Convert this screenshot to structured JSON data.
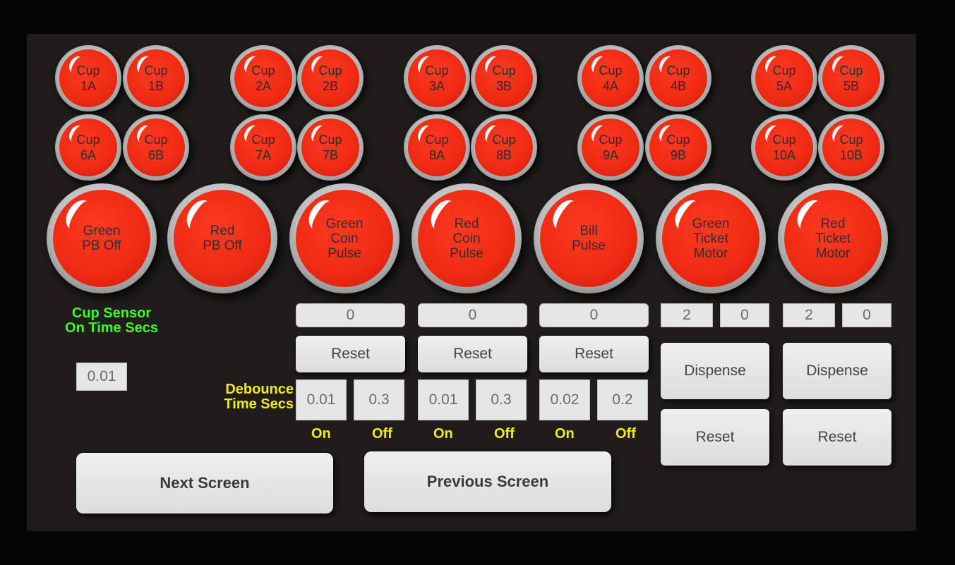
{
  "cups": [
    {
      "line1": "Cup",
      "line2": "1A"
    },
    {
      "line1": "Cup",
      "line2": "1B"
    },
    {
      "line1": "Cup",
      "line2": "2A"
    },
    {
      "line1": "Cup",
      "line2": "2B"
    },
    {
      "line1": "Cup",
      "line2": "3A"
    },
    {
      "line1": "Cup",
      "line2": "3B"
    },
    {
      "line1": "Cup",
      "line2": "4A"
    },
    {
      "line1": "Cup",
      "line2": "4B"
    },
    {
      "line1": "Cup",
      "line2": "5A"
    },
    {
      "line1": "Cup",
      "line2": "5B"
    },
    {
      "line1": "Cup",
      "line2": "6A"
    },
    {
      "line1": "Cup",
      "line2": "6B"
    },
    {
      "line1": "Cup",
      "line2": "7A"
    },
    {
      "line1": "Cup",
      "line2": "7B"
    },
    {
      "line1": "Cup",
      "line2": "8A"
    },
    {
      "line1": "Cup",
      "line2": "8B"
    },
    {
      "line1": "Cup",
      "line2": "9A"
    },
    {
      "line1": "Cup",
      "line2": "9B"
    },
    {
      "line1": "Cup",
      "line2": "10A"
    },
    {
      "line1": "Cup",
      "line2": "10B"
    }
  ],
  "big_buttons": [
    {
      "label": "Green\nPB Off"
    },
    {
      "label": "Red\nPB Off"
    },
    {
      "label": "Green\nCoin\nPulse"
    },
    {
      "label": "Red\nCoin\nPulse"
    },
    {
      "label": "Bill\nPulse"
    },
    {
      "label": "Green\nTicket\nMotor"
    },
    {
      "label": "Red\nTicket\nMotor"
    }
  ],
  "cup_sensor": {
    "title_line1": "Cup Sensor",
    "title_line2": "On Time Secs",
    "value": "0.01"
  },
  "debounce": {
    "title_line1": "Debounce",
    "title_line2": "Time Secs"
  },
  "counters": [
    {
      "count": "0",
      "reset": "Reset",
      "on": "0.01",
      "off": "0.3",
      "on_label": "On",
      "off_label": "Off"
    },
    {
      "count": "0",
      "reset": "Reset",
      "on": "0.01",
      "off": "0.3",
      "on_label": "On",
      "off_label": "Off"
    },
    {
      "count": "0",
      "reset": "Reset",
      "on": "0.02",
      "off": "0.2",
      "on_label": "On",
      "off_label": "Off"
    }
  ],
  "tickets": [
    {
      "val_a": "2",
      "val_b": "0",
      "dispense": "Dispense",
      "reset": "Reset"
    },
    {
      "val_a": "2",
      "val_b": "0",
      "dispense": "Dispense",
      "reset": "Reset"
    }
  ],
  "nav": {
    "next": "Next Screen",
    "previous": "Previous Screen"
  },
  "colors": {
    "button_red": "#ee2a14",
    "label_green": "#3cff2a",
    "label_yellow": "#f2ea1c",
    "panel": "#1f1c1b"
  }
}
